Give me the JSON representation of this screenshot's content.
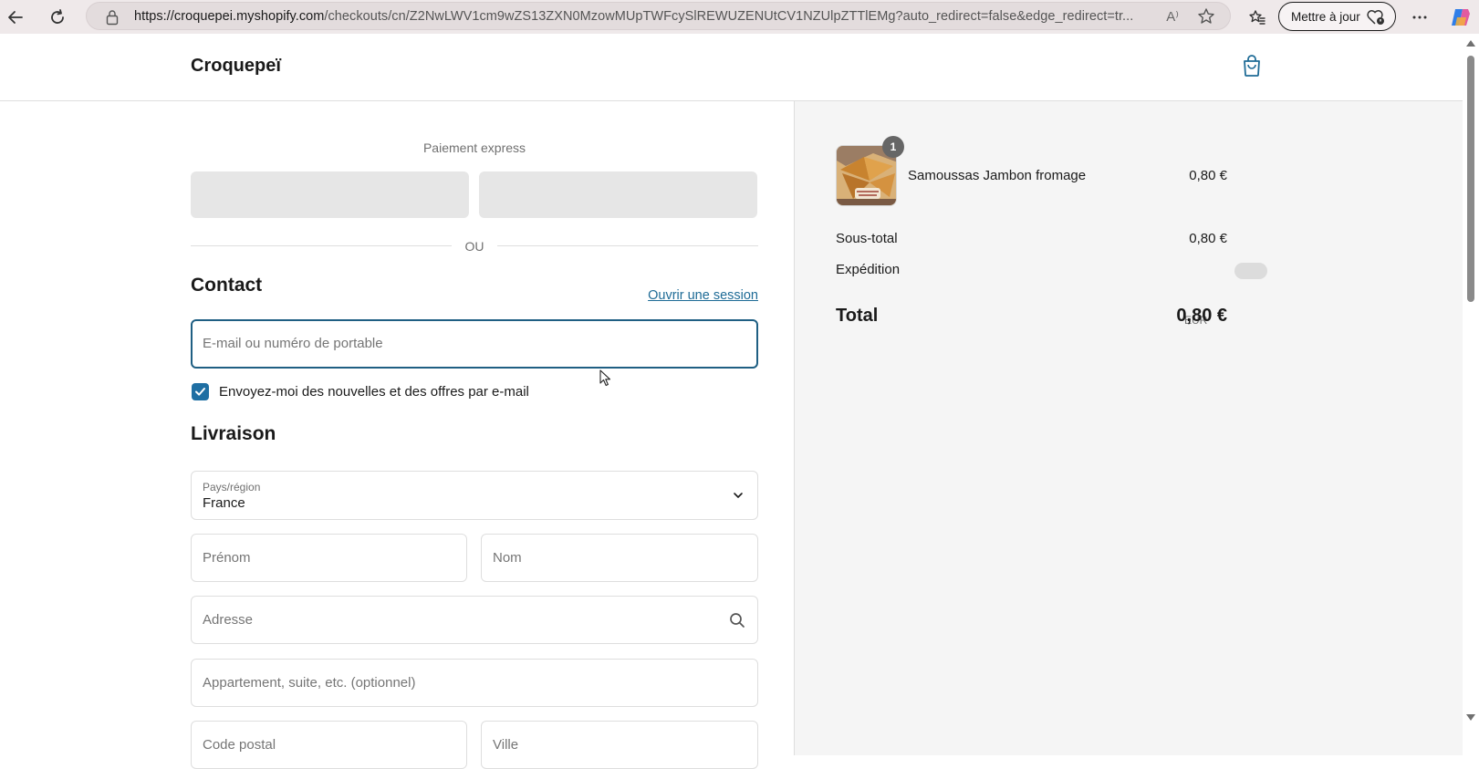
{
  "browser": {
    "url_host": "https://croquepei.myshopify.com",
    "url_path": "/checkouts/cn/Z2NwLWV1cm9wZS13ZXN0MzowMUpTWFcySlREWUZENUtCV1NZUlpZTTlEMg?auto_redirect=false&edge_redirect=tr...",
    "read_aloud": "A⁾",
    "update_label": "Mettre à jour"
  },
  "header": {
    "logo": "Croquepeï"
  },
  "express": {
    "title": "Paiement express",
    "or_label": "OU"
  },
  "contact": {
    "title": "Contact",
    "login_link": "Ouvrir une session",
    "email_placeholder": "E-mail ou numéro de portable",
    "newsletter_label": "Envoyez-moi des nouvelles et des offres par e-mail",
    "newsletter_checked": true
  },
  "delivery": {
    "title": "Livraison",
    "country_label": "Pays/région",
    "country_value": "France",
    "first_name_placeholder": "Prénom",
    "last_name_placeholder": "Nom",
    "address_placeholder": "Adresse",
    "apartment_placeholder": "Appartement, suite, etc. (optionnel)",
    "postal_placeholder": "Code postal",
    "city_placeholder": "Ville"
  },
  "summary": {
    "product": {
      "name": "Samoussas Jambon fromage",
      "price": "0,80 €",
      "quantity": "1"
    },
    "subtotal_label": "Sous-total",
    "subtotal_value": "0,80 €",
    "shipping_label": "Expédition",
    "total_label": "Total",
    "total_currency": "EUR",
    "total_value": "0,80 €"
  },
  "colors": {
    "accent": "#1f5f83",
    "link": "#1e6b96",
    "checkbox": "#1f6fa3",
    "summary_bg": "#f5f5f5"
  }
}
